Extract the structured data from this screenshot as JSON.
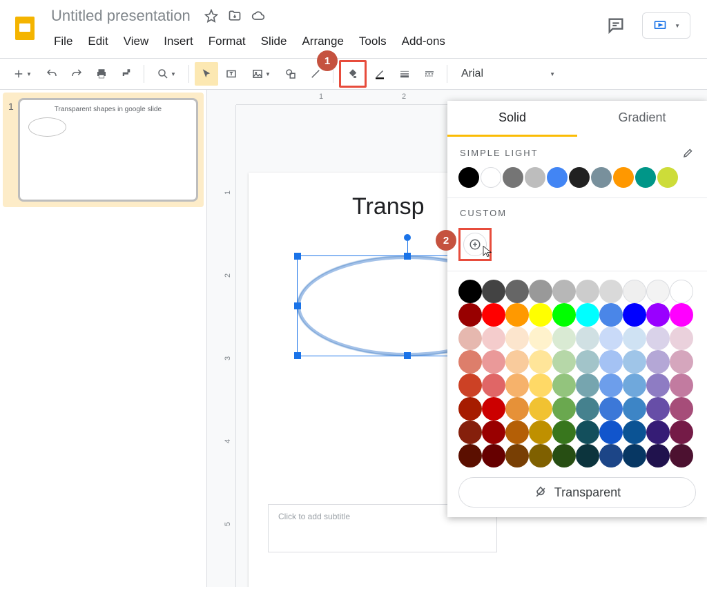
{
  "doc": {
    "title": "Untitled presentation"
  },
  "menubar": [
    "File",
    "Edit",
    "View",
    "Insert",
    "Format",
    "Slide",
    "Arrange",
    "Tools",
    "Add-ons"
  ],
  "toolbar": {
    "font": "Arial"
  },
  "callouts": {
    "one": "1",
    "two": "2"
  },
  "thumb": {
    "number": "1",
    "title": "Transparent shapes in google slide"
  },
  "ruler": {
    "h": [
      "1",
      "2"
    ],
    "v": [
      "1",
      "2",
      "3",
      "4",
      "5"
    ]
  },
  "slide": {
    "title": "Transp",
    "subtitle_placeholder": "Click to add subtitle"
  },
  "fillPopup": {
    "tabs": {
      "solid": "Solid",
      "gradient": "Gradient"
    },
    "sections": {
      "simpleLight": "SIMPLE LIGHT",
      "custom": "CUSTOM"
    },
    "transparent": "Transparent",
    "themeColors": [
      "#000000",
      "#ffffff",
      "#757575",
      "#bdbdbd",
      "#4285f4",
      "#212121",
      "#78909c",
      "#ff9800",
      "#009688",
      "#cddc39"
    ],
    "greys": [
      "#000000",
      "#434343",
      "#666666",
      "#999999",
      "#b7b7b7",
      "#cccccc",
      "#d9d9d9",
      "#efefef",
      "#f3f3f3",
      "#ffffff"
    ],
    "brights": [
      "#980000",
      "#ff0000",
      "#ff9900",
      "#ffff00",
      "#00ff00",
      "#00ffff",
      "#4a86e8",
      "#0000ff",
      "#9900ff",
      "#ff00ff"
    ],
    "palette": [
      [
        "#e6b8af",
        "#f4cccc",
        "#fce5cd",
        "#fff2cc",
        "#d9ead3",
        "#d0e0e3",
        "#c9daf8",
        "#cfe2f3",
        "#d9d2e9",
        "#ead1dc"
      ],
      [
        "#dd7e6b",
        "#ea9999",
        "#f9cb9c",
        "#ffe599",
        "#b6d7a8",
        "#a2c4c9",
        "#a4c2f4",
        "#9fc5e8",
        "#b4a7d6",
        "#d5a6bd"
      ],
      [
        "#cc4125",
        "#e06666",
        "#f6b26b",
        "#ffd966",
        "#93c47d",
        "#76a5af",
        "#6d9eeb",
        "#6fa8dc",
        "#8e7cc3",
        "#c27ba0"
      ],
      [
        "#a61c00",
        "#cc0000",
        "#e69138",
        "#f1c232",
        "#6aa84f",
        "#45818e",
        "#3c78d8",
        "#3d85c6",
        "#674ea7",
        "#a64d79"
      ],
      [
        "#85200c",
        "#990000",
        "#b45f06",
        "#bf9000",
        "#38761d",
        "#134f5c",
        "#1155cc",
        "#0b5394",
        "#351c75",
        "#741b47"
      ],
      [
        "#5b0f00",
        "#660000",
        "#783f04",
        "#7f6000",
        "#274e13",
        "#0c343d",
        "#1c4587",
        "#073763",
        "#20124d",
        "#4c1130"
      ]
    ]
  }
}
